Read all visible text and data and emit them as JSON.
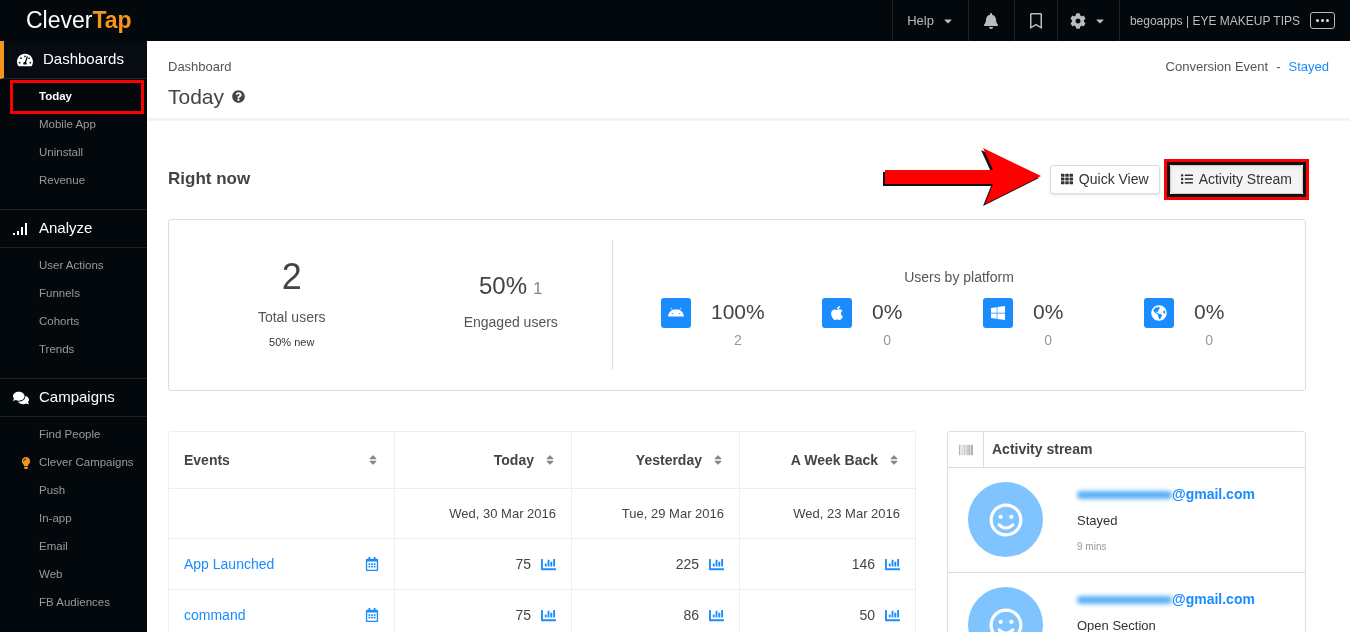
{
  "topbar": {
    "logo": [
      "Clever",
      "Tap"
    ],
    "help": "Help",
    "account": "begoapps | EYE MAKEUP TIPS"
  },
  "sidebar": [
    {
      "title": "Dashboards",
      "kind": "dashboard",
      "active": true,
      "items": [
        {
          "label": "Today",
          "selected": true,
          "annotated": true
        },
        {
          "label": "Mobile App",
          "selected": false,
          "annotated": false
        },
        {
          "label": "Uninstall",
          "selected": false,
          "annotated": false
        },
        {
          "label": "Revenue",
          "selected": false,
          "annotated": false
        }
      ]
    },
    {
      "title": "Analyze",
      "kind": "signal",
      "active": false,
      "items": [
        {
          "label": "User Actions",
          "selected": false,
          "annotated": false
        },
        {
          "label": "Funnels",
          "selected": false,
          "annotated": false
        },
        {
          "label": "Cohorts",
          "selected": false,
          "annotated": false
        },
        {
          "label": "Trends",
          "selected": false,
          "annotated": false
        }
      ]
    },
    {
      "title": "Campaigns",
      "kind": "chat",
      "active": false,
      "items": [
        {
          "label": "Find People",
          "selected": false,
          "annotated": false
        },
        {
          "label": "Clever Campaigns",
          "selected": false,
          "annotated": false,
          "kind": "bulb"
        },
        {
          "label": "Push",
          "selected": false,
          "annotated": false
        },
        {
          "label": "In-app",
          "selected": false,
          "annotated": false
        },
        {
          "label": "Email",
          "selected": false,
          "annotated": false
        },
        {
          "label": "Web",
          "selected": false,
          "annotated": false
        },
        {
          "label": "FB Audiences",
          "selected": false,
          "annotated": false
        }
      ]
    }
  ],
  "header": {
    "breadcrumb": "Dashboard",
    "title": "Today",
    "conversion_label": "Conversion Event",
    "separator": "-",
    "conversion_value": "Stayed"
  },
  "section_title": "Right now",
  "view_buttons": [
    {
      "label": "Quick View",
      "kind": "grid",
      "selected": false,
      "annotated": false
    },
    {
      "label": "Activity Stream",
      "kind": "list",
      "selected": true,
      "annotated": true
    }
  ],
  "stats": {
    "total": {
      "value": "2",
      "label": "Total users",
      "sub": "50% new"
    },
    "engaged": {
      "value": "50%",
      "count": "1",
      "label": "Engaged users"
    },
    "platform_title": "Users by platform",
    "platforms": [
      {
        "kind": "android",
        "percent": "100%",
        "count": "2"
      },
      {
        "kind": "apple",
        "percent": "0%",
        "count": "0"
      },
      {
        "kind": "windows",
        "percent": "0%",
        "count": "0"
      },
      {
        "kind": "web",
        "percent": "0%",
        "count": "0"
      }
    ]
  },
  "events_table": {
    "columns": [
      "Events",
      "Today",
      "Yesterday",
      "A Week Back"
    ],
    "dates": [
      "Wed, 30 Mar 2016",
      "Tue, 29 Mar 2016",
      "Wed, 23 Mar 2016"
    ],
    "rows": [
      {
        "name": "App Launched",
        "values": [
          "75",
          "225",
          "146"
        ]
      },
      {
        "name": "command",
        "values": [
          "75",
          "86",
          "50"
        ]
      }
    ]
  },
  "activity_stream": {
    "title": "Activity stream",
    "items": [
      {
        "email": "@gmail.com",
        "event": "Stayed",
        "time": "9 mins"
      },
      {
        "email": "@gmail.com",
        "event": "Open Section"
      }
    ]
  }
}
